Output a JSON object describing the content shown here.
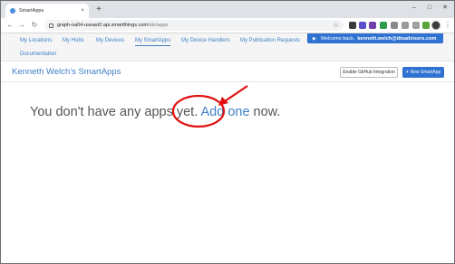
{
  "browser": {
    "tab_title": "SmartApps",
    "tab_close": "×",
    "new_tab": "+",
    "url_host": "graph-na04-useast2.api.smartthings.com",
    "url_path": "/ide/apps",
    "win_min": "–",
    "win_max": "□",
    "win_close": "✕",
    "back": "←",
    "forward": "→",
    "reload": "↻",
    "star": "☆",
    "menu": "⋮"
  },
  "nav": {
    "items": [
      "My Locations",
      "My Hubs",
      "My Devices",
      "My SmartApps",
      "My Device Handlers",
      "My Publication Requests",
      "Documentation"
    ],
    "active": "My SmartApps"
  },
  "welcome": {
    "prefix": "Welcome back,",
    "email": "kenneth.welch@dtsadvisors.com",
    "chevron": "▶"
  },
  "page": {
    "title": "Kenneth Welch's SmartApps",
    "github_button": "Enable GitHub Integration",
    "new_button": "New SmartApp",
    "new_plus": "+"
  },
  "empty_state": {
    "before": "You don't have any apps yet.",
    "link": "Add one",
    "after": "now."
  },
  "colors": {
    "accent": "#2f72d1",
    "link": "#3f7fc7",
    "annotation": "#e01010"
  },
  "icons": [
    "lock-icon",
    "star-icon",
    "back-icon",
    "forward-icon",
    "reload-icon",
    "menu-icon"
  ]
}
